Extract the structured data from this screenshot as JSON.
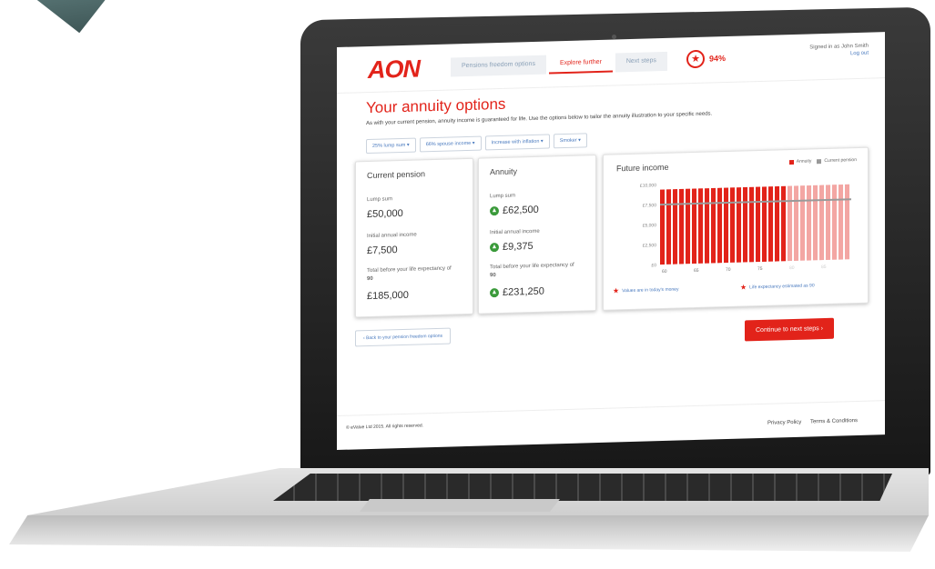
{
  "header": {
    "logo": "AON",
    "nav": [
      "Pensions freedom options",
      "Explore further",
      "Next steps"
    ],
    "progress_percent": "94%",
    "signed_in": "Signed in as John Smith",
    "logout": "Log out"
  },
  "page": {
    "title": "Your annuity options",
    "subtitle": "As with your current pension, annuity income is guaranteed for life. Use the options below to tailor the annuity illustration to your specific needs."
  },
  "options": [
    "25% lump sum",
    "66% spouse income",
    "Increase with inflation",
    "Smoker"
  ],
  "current": {
    "title": "Current pension",
    "lump_label": "Lump sum",
    "lump_value": "£50,000",
    "income_label": "Initial annual income",
    "income_value": "£7,500",
    "total_label": "Total before your life expectancy of",
    "life_expectancy": "90",
    "total_value": "£185,000"
  },
  "annuity": {
    "title": "Annuity",
    "lump_label": "Lump sum",
    "lump_value": "£62,500",
    "income_label": "Initial annual income",
    "income_value": "£9,375",
    "total_label": "Total before your life expectancy of",
    "life_expectancy": "90",
    "total_value": "£231,250"
  },
  "chart_data": {
    "type": "bar",
    "title": "Future income",
    "legend": [
      "Annuity",
      "Current pension"
    ],
    "x_tick_labels": [
      "60",
      "65",
      "70",
      "75",
      "80",
      "85"
    ],
    "y_tick_labels": [
      "£10,000",
      "£7,500",
      "£5,000",
      "£2,500",
      "£0"
    ],
    "ylim": [
      0,
      10000
    ],
    "annuity_value": 9375,
    "current_pension_value": 7500,
    "years_solid": 20,
    "years_faded": 10,
    "note_left": "Values are in today's money",
    "note_right": "Life expectancy estimated as 90"
  },
  "actions": {
    "back": "Back to your pension freedom options",
    "continue": "Continue to next steps"
  },
  "footer": {
    "copyright": "© eValue Ltd 2015. All rights reserved.",
    "privacy": "Privacy Policy",
    "terms": "Terms & Conditions"
  },
  "colors": {
    "brand": "#e2231a",
    "link": "#4b7bbf",
    "positive": "#3a9a3a"
  }
}
